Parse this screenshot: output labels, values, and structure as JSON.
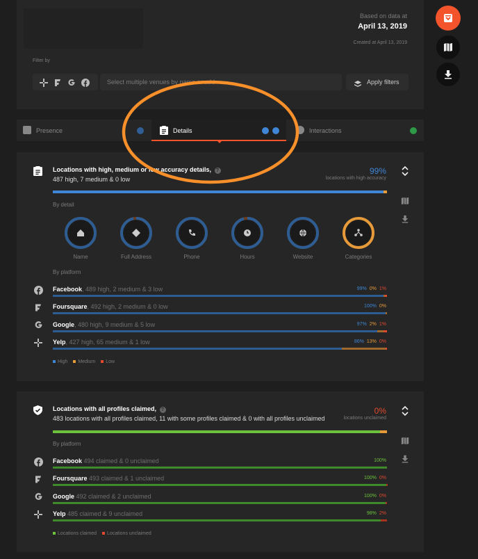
{
  "header": {
    "based_on": "Based on data at",
    "date": "April 13, 2019",
    "created": "Created at April 13, 2019",
    "filter_label": "Filter by",
    "venue_placeholder": "Select multiple venues by name or add",
    "apply_label": "Apply filters"
  },
  "tabs": [
    {
      "label": "Presence"
    },
    {
      "label": "Details"
    },
    {
      "label": "Interactions"
    }
  ],
  "accuracy": {
    "title": "Locations with high, medium or low accuracy details,",
    "subtitle": "487 high, 7 medium & 0 low",
    "percent": "99%",
    "percent_caption": "locations with high accuracy",
    "by_detail": "By detail",
    "by_platform": "By platform",
    "details": [
      {
        "label": "Name",
        "fill": 1.0
      },
      {
        "label": "Full Address",
        "fill": 0.97
      },
      {
        "label": "Phone",
        "fill": 1.0
      },
      {
        "label": "Hours",
        "fill": 0.96
      },
      {
        "label": "Website",
        "fill": 1.0
      },
      {
        "label": "Categories",
        "fill": 0.0
      }
    ],
    "platforms": [
      {
        "name": "Facebook",
        "desc": ", 489 high, 2 medium & 3 low",
        "high": "99%",
        "med": "0%",
        "low": "1%",
        "high_v": 0.99,
        "med_v": 0.004,
        "low_v": 0.006,
        "icon": "facebook-icon"
      },
      {
        "name": "Foursquare",
        "desc": ", 492 high, 2 medium & 0 low",
        "high": "100%",
        "med": "0%",
        "low": "",
        "high_v": 0.996,
        "med_v": 0.004,
        "low_v": 0,
        "icon": "foursquare-icon"
      },
      {
        "name": "Google",
        "desc": ", 480 high, 9 medium & 5 low",
        "high": "97%",
        "med": "2%",
        "low": "1%",
        "high_v": 0.97,
        "med_v": 0.02,
        "low_v": 0.01,
        "icon": "google-icon"
      },
      {
        "name": "Yelp",
        "desc": ", 427 high, 65 medium & 1 low",
        "high": "86%",
        "med": "13%",
        "low": "0%",
        "high_v": 0.865,
        "med_v": 0.13,
        "low_v": 0.005,
        "icon": "yelp-icon"
      }
    ],
    "legend": {
      "high": "High",
      "medium": "Medium",
      "low": "Low"
    }
  },
  "claimed": {
    "title": "Locations with all profiles claimed,",
    "subtitle": "483 locations with all profiles claimed, 11 with some profiles claimed & 0 with all profiles unclaimed",
    "percent": "0%",
    "percent_caption": "locations unclaimed",
    "by_platform": "By platform",
    "platforms": [
      {
        "name": "Facebook",
        "desc": "494 claimed & 0 unclaimed",
        "claimed": "100%",
        "unclaimed": "",
        "claimed_v": 1.0,
        "unclaimed_v": 0,
        "icon": "facebook-icon"
      },
      {
        "name": "Foursquare",
        "desc": "493 claimed & 1 unclaimed",
        "claimed": "100%",
        "unclaimed": "0%",
        "claimed_v": 0.998,
        "unclaimed_v": 0.002,
        "icon": "foursquare-icon"
      },
      {
        "name": "Google",
        "desc": "492 claimed & 2 unclaimed",
        "claimed": "100%",
        "unclaimed": "0%",
        "claimed_v": 0.996,
        "unclaimed_v": 0.004,
        "icon": "google-icon"
      },
      {
        "name": "Yelp",
        "desc": "485 claimed & 9 unclaimed",
        "claimed": "98%",
        "unclaimed": "2%",
        "claimed_v": 0.982,
        "unclaimed_v": 0.018,
        "icon": "yelp-icon"
      }
    ],
    "legend": {
      "claimed": "Locations claimed",
      "unclaimed": "Locations unclaimed"
    }
  },
  "colors": {
    "high": "#3f86d6",
    "medium": "#e69a3a",
    "low": "#e0492e",
    "claimed": "#6cc23c",
    "accent": "#f4542c",
    "annotation": "#f7902a"
  }
}
